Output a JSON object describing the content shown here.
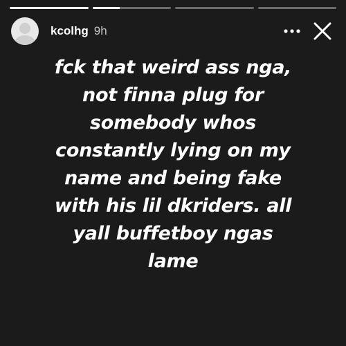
{
  "story": {
    "progress": [
      1,
      0.35,
      0,
      0
    ],
    "user": {
      "username": "kcolhg",
      "time": "9h"
    },
    "icons": {
      "more": "more-horizontal-icon",
      "close": "close-icon"
    },
    "caption_lines": [
      "fck that weird ass nga,",
      "not finna plug for",
      "somebody whos",
      "constantly lying on my",
      "name and being fake",
      "with his lil dkriders. all",
      "yall buffetboy ngas",
      "lame"
    ]
  },
  "colors": {
    "background": "#1b1b1b",
    "text": "#ffffff"
  }
}
